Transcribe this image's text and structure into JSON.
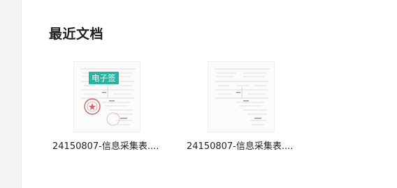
{
  "section": {
    "title": "最近文档"
  },
  "documents": [
    {
      "name": "24150807-信息采集表....",
      "badge": "电子签",
      "has_seal": true
    },
    {
      "name": "24150807-信息采集表....",
      "badge": "",
      "has_seal": false
    }
  ],
  "colors": {
    "badge_bg": "#27b3a2",
    "seal": "#c94a4a",
    "rail_bg": "#f2f3f5"
  }
}
